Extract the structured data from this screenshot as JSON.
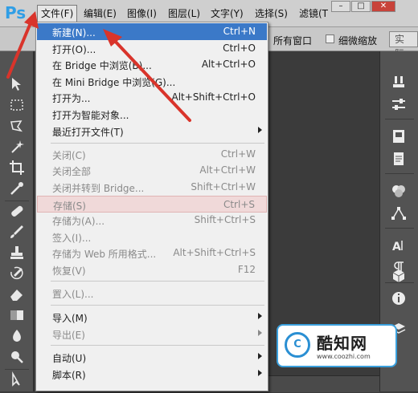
{
  "app": {
    "logo": "Ps"
  },
  "menubar": {
    "items": [
      {
        "label": "文件(F)"
      },
      {
        "label": "编辑(E)"
      },
      {
        "label": "图像(I)"
      },
      {
        "label": "图层(L)"
      },
      {
        "label": "文字(Y)"
      },
      {
        "label": "选择(S)"
      },
      {
        "label": "滤镜(T"
      }
    ],
    "window_controls": {
      "minimize": "–",
      "maximize": "□",
      "close": "✕"
    }
  },
  "options_bar": {
    "text1": "所有窗口",
    "checkbox_label": "细微缩放",
    "button_label": "实际"
  },
  "file_menu": {
    "items": [
      {
        "label": "新建(N)...",
        "shortcut": "Ctrl+N",
        "state": "highlighted"
      },
      {
        "label": "打开(O)...",
        "shortcut": "Ctrl+O",
        "state": "enabled"
      },
      {
        "label": "在 Bridge 中浏览(B)...",
        "shortcut": "Alt+Ctrl+O",
        "state": "enabled"
      },
      {
        "label": "在 Mini Bridge 中浏览(G)...",
        "shortcut": "",
        "state": "enabled"
      },
      {
        "label": "打开为...",
        "shortcut": "Alt+Shift+Ctrl+O",
        "state": "enabled"
      },
      {
        "label": "打开为智能对象...",
        "shortcut": "",
        "state": "enabled"
      },
      {
        "label": "最近打开文件(T)",
        "shortcut": "",
        "state": "enabled",
        "submenu": true
      },
      {
        "label": "关闭(C)",
        "shortcut": "Ctrl+W",
        "state": "disabled"
      },
      {
        "label": "关闭全部",
        "shortcut": "Alt+Ctrl+W",
        "state": "disabled"
      },
      {
        "label": "关闭并转到 Bridge...",
        "shortcut": "Shift+Ctrl+W",
        "state": "disabled"
      },
      {
        "label": "存储(S)",
        "shortcut": "Ctrl+S",
        "state": "disabled-hover"
      },
      {
        "label": "存储为(A)...",
        "shortcut": "Shift+Ctrl+S",
        "state": "disabled"
      },
      {
        "label": "签入(I)...",
        "shortcut": "",
        "state": "disabled"
      },
      {
        "label": "存储为 Web 所用格式...",
        "shortcut": "Alt+Shift+Ctrl+S",
        "state": "disabled"
      },
      {
        "label": "恢复(V)",
        "shortcut": "F12",
        "state": "disabled"
      },
      {
        "label": "置入(L)...",
        "shortcut": "",
        "state": "disabled"
      },
      {
        "label": "导入(M)",
        "shortcut": "",
        "state": "enabled",
        "submenu": true
      },
      {
        "label": "导出(E)",
        "shortcut": "",
        "state": "disabled",
        "submenu": true
      },
      {
        "label": "自动(U)",
        "shortcut": "",
        "state": "enabled",
        "submenu": true
      },
      {
        "label": "脚本(R)",
        "shortcut": "",
        "state": "enabled",
        "submenu": true
      }
    ]
  },
  "watermark": {
    "name": "酷知网",
    "url": "www.coozhi.com",
    "logo_text": "C"
  },
  "colors": {
    "accent": "#3b79c8",
    "arrow": "#d9342b",
    "logo": "#2f9ee6"
  }
}
